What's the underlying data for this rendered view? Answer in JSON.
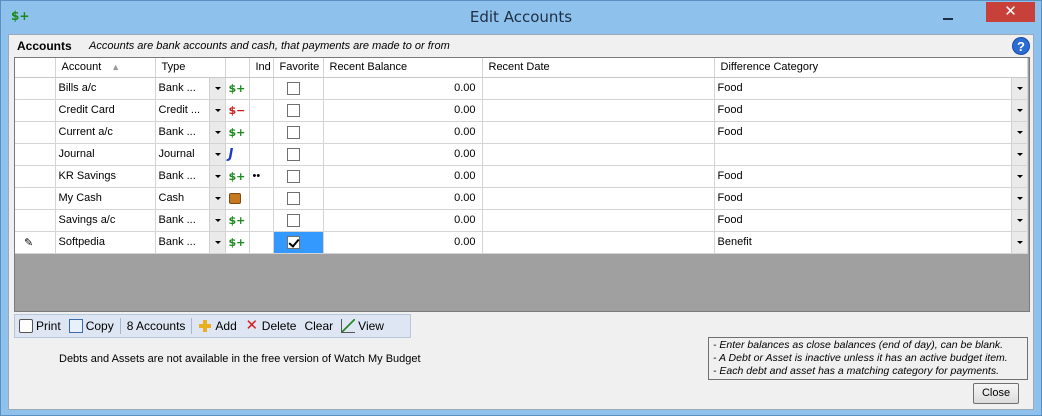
{
  "window": {
    "title": "Edit Accounts",
    "close_glyph": "✕",
    "app_icon_text": "$+"
  },
  "header": {
    "label": "Accounts",
    "description": "Accounts are bank accounts and cash, that payments are made to or from",
    "help_glyph": "?"
  },
  "grid": {
    "columns": {
      "account": "Account",
      "type": "Type",
      "ind": "Ind",
      "favorite": "Favorite",
      "recent_balance": "Recent Balance",
      "recent_date": "Recent Date",
      "difference_category": "Difference Category"
    },
    "rows": [
      {
        "account": "Bills a/c",
        "type": "Bank ...",
        "type_icon": "bank-icon",
        "ind": "",
        "favorite": false,
        "balance": "0.00",
        "date": "",
        "category": "Food"
      },
      {
        "account": "Credit Card",
        "type": "Credit ...",
        "type_icon": "credit-icon",
        "ind": "",
        "favorite": false,
        "balance": "0.00",
        "date": "",
        "category": "Food"
      },
      {
        "account": "Current a/c",
        "type": "Bank ...",
        "type_icon": "bank-icon",
        "ind": "",
        "favorite": false,
        "balance": "0.00",
        "date": "",
        "category": "Food"
      },
      {
        "account": "Journal",
        "type": "Journal",
        "type_icon": "journal-icon",
        "ind": "",
        "favorite": false,
        "balance": "0.00",
        "date": "",
        "category": ""
      },
      {
        "account": "KR Savings",
        "type": "Bank ...",
        "type_icon": "bank-icon",
        "ind": "••",
        "favorite": false,
        "balance": "0.00",
        "date": "",
        "category": "Food"
      },
      {
        "account": "My Cash",
        "type": "Cash",
        "type_icon": "cash-icon",
        "ind": "",
        "favorite": false,
        "balance": "0.00",
        "date": "",
        "category": "Food"
      },
      {
        "account": "Savings a/c",
        "type": "Bank ...",
        "type_icon": "bank-icon",
        "ind": "",
        "favorite": false,
        "balance": "0.00",
        "date": "",
        "category": "Food"
      },
      {
        "account": "Softpedia",
        "type": "Bank ...",
        "type_icon": "bank-icon",
        "ind": "",
        "favorite": true,
        "balance": "0.00",
        "date": "",
        "category": "Benefit",
        "editing": true
      }
    ],
    "type_glyphs": {
      "bank": "$+",
      "credit": "$−",
      "journal": "J"
    },
    "editing_glyph": "✎"
  },
  "toolbar": {
    "print": "Print",
    "copy": "Copy",
    "count": "8 Accounts",
    "add": "Add",
    "delete": "Delete",
    "delete_glyph": "✕",
    "clear": "Clear",
    "view": "View"
  },
  "note": "Debts and Assets are not available in the free version of Watch My Budget",
  "hints": [
    "- Enter balances as close balances (end of day), can be blank.",
    "- A Debt or Asset is inactive unless it has an active budget item.",
    "- Each debt and asset has a matching category for payments."
  ],
  "close_button": "Close"
}
